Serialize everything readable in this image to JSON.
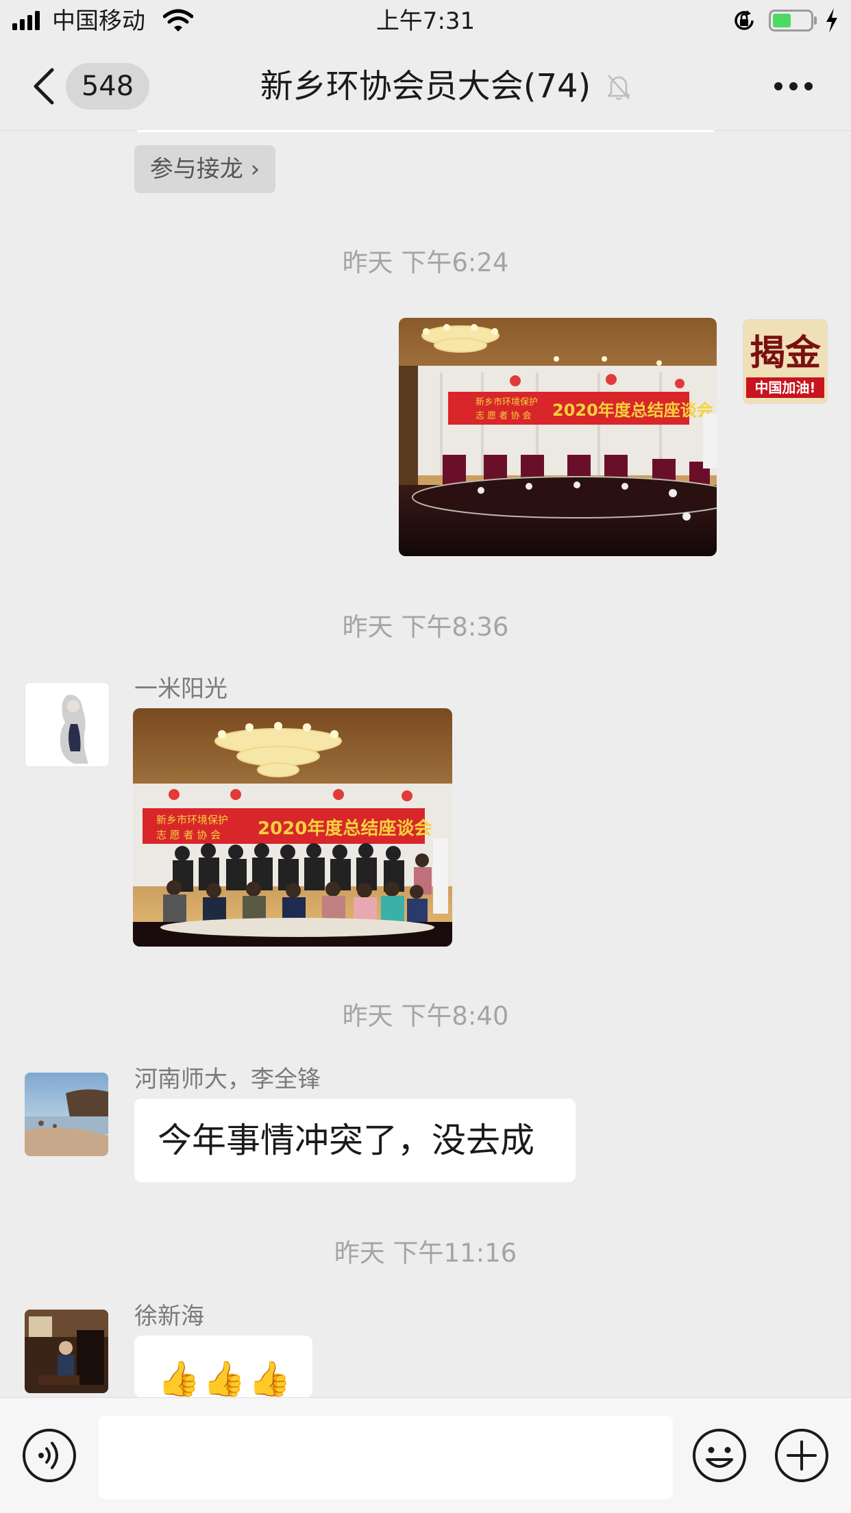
{
  "status_bar": {
    "carrier": "中国移动",
    "time": "上午7:31",
    "icons": [
      "signal-icon",
      "wifi-icon",
      "rotation-lock-icon",
      "battery-icon",
      "charging-icon"
    ],
    "battery_color": "#4cd964"
  },
  "nav": {
    "unread_count": "548",
    "title": "新乡环协会员大会(74)",
    "icons": [
      "back-chevron-icon",
      "mute-bell-icon",
      "more-dots-icon"
    ]
  },
  "chat": {
    "join_chip_label": "参与接龙 ›",
    "messages": [
      {
        "timestamp": "昨天 下午6:24",
        "type": "image",
        "outgoing": true,
        "avatar_text_art": "揭金",
        "avatar_caption": "中国加油!",
        "photo_banner_line1": "新乡市环境保护",
        "photo_banner_line2": "志 愿 者 协 会",
        "photo_banner_title": "2020年度总结座谈会"
      },
      {
        "timestamp": "昨天 下午8:36",
        "type": "image",
        "sender": "一米阳光",
        "photo_banner_line1": "新乡市环境保护",
        "photo_banner_line2": "志 愿 者 协 会",
        "photo_banner_title": "2020年度总结座谈会"
      },
      {
        "timestamp": "昨天 下午8:40",
        "type": "text",
        "sender": "河南师大，李全锋",
        "text": "今年事情冲突了，没去成"
      },
      {
        "timestamp": "昨天 下午11:16",
        "type": "emoji",
        "sender": "徐新海",
        "emoji": "👍👍👍"
      }
    ]
  },
  "input_bar": {
    "icons": [
      "voice-icon",
      "emoji-icon",
      "plus-icon"
    ],
    "placeholder": ""
  },
  "colors": {
    "background": "#ededed",
    "bubble": "#ffffff",
    "timestamp": "#a4a4a4",
    "banner_red": "#d8262b",
    "banner_gold": "#f3d33b"
  }
}
